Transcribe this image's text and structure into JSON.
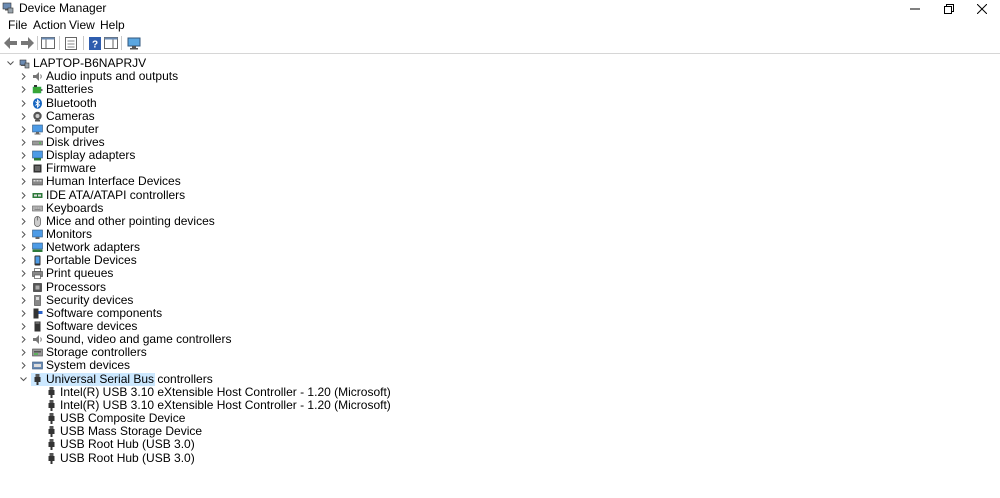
{
  "window": {
    "title": "Device Manager"
  },
  "menu": [
    "File",
    "Action",
    "View",
    "Help"
  ],
  "tree": {
    "root": "LAPTOP-B6NAPRJV",
    "categories": [
      {
        "label": "Audio inputs and outputs",
        "icon": "speaker-icon"
      },
      {
        "label": "Batteries",
        "icon": "battery-icon"
      },
      {
        "label": "Bluetooth",
        "icon": "bluetooth-icon"
      },
      {
        "label": "Cameras",
        "icon": "camera-icon"
      },
      {
        "label": "Computer",
        "icon": "computer-icon"
      },
      {
        "label": "Disk drives",
        "icon": "disk-drive-icon"
      },
      {
        "label": "Display adapters",
        "icon": "display-adapter-icon"
      },
      {
        "label": "Firmware",
        "icon": "firmware-icon"
      },
      {
        "label": "Human Interface Devices",
        "icon": "hid-icon"
      },
      {
        "label": "IDE ATA/ATAPI controllers",
        "icon": "ide-controller-icon"
      },
      {
        "label": "Keyboards",
        "icon": "keyboard-icon"
      },
      {
        "label": "Mice and other pointing devices",
        "icon": "mouse-icon"
      },
      {
        "label": "Monitors",
        "icon": "monitor-icon"
      },
      {
        "label": "Network adapters",
        "icon": "network-adapter-icon"
      },
      {
        "label": "Portable Devices",
        "icon": "portable-device-icon"
      },
      {
        "label": "Print queues",
        "icon": "printer-icon"
      },
      {
        "label": "Processors",
        "icon": "processor-icon"
      },
      {
        "label": "Security devices",
        "icon": "security-device-icon"
      },
      {
        "label": "Software components",
        "icon": "software-component-icon"
      },
      {
        "label": "Software devices",
        "icon": "software-device-icon"
      },
      {
        "label": "Sound, video and game controllers",
        "icon": "sound-icon"
      },
      {
        "label": "Storage controllers",
        "icon": "storage-controller-icon"
      },
      {
        "label": "System devices",
        "icon": "system-device-icon"
      },
      {
        "label": "Universal Serial Bus controllers",
        "icon": "usb-icon"
      }
    ],
    "expanded": {
      "category": "Universal Serial Bus controllers",
      "children": [
        "Intel(R) USB 3.10 eXtensible Host Controller - 1.20 (Microsoft)",
        "Intel(R) USB 3.10 eXtensible Host Controller - 1.20 (Microsoft)",
        "USB Composite Device",
        "USB Mass Storage Device",
        "USB Root Hub (USB 3.0)",
        "USB Root Hub (USB 3.0)"
      ]
    }
  },
  "colors": {
    "selection": "#cce8ff",
    "chevron": "#555555"
  }
}
